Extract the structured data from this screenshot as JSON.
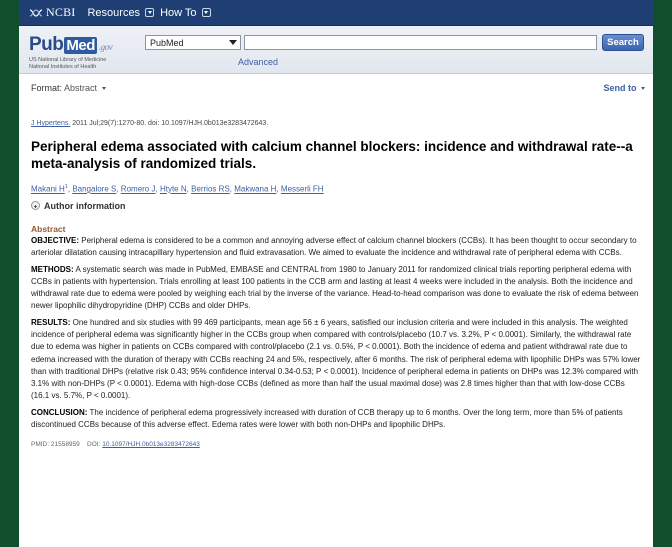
{
  "ncbi_bar": {
    "logo": "NCBI",
    "resources": "Resources",
    "howto": "How To"
  },
  "header": {
    "logo_pub": "Pub",
    "logo_med": "Med",
    "logo_gov": ".gov",
    "nlm_line1": "US National Library of Medicine",
    "nlm_line2": "National Institutes of Health",
    "database": "PubMed",
    "search_value": "",
    "search_button": "Search",
    "advanced": "Advanced"
  },
  "format_bar": {
    "format_label": "Format:",
    "format_value": "Abstract",
    "send_to": "Send to"
  },
  "article": {
    "journal": "J Hypertens.",
    "citation_rest": " 2011 Jul;29(7):1270-80. doi: 10.1097/HJH.0b013e3283472643.",
    "title": "Peripheral edema associated with calcium channel blockers: incidence and withdrawal rate--a meta-analysis of randomized trials.",
    "authors": [
      {
        "name": "Makani H",
        "sup": "1"
      },
      {
        "name": "Bangalore S",
        "sup": ""
      },
      {
        "name": "Romero J",
        "sup": ""
      },
      {
        "name": "Htyte N",
        "sup": ""
      },
      {
        "name": "Berrios RS",
        "sup": ""
      },
      {
        "name": "Makwana H",
        "sup": ""
      },
      {
        "name": "Messerli FH",
        "sup": ""
      }
    ],
    "author_info": "Author information",
    "abstract_heading": "Abstract",
    "sections": [
      {
        "label": "OBJECTIVE:",
        "text": " Peripheral edema is considered to be a common and annoying adverse effect of calcium channel blockers (CCBs). It has been thought to occur secondary to arteriolar dilatation causing intracapillary hypertension and fluid extravasation. We aimed to evaluate the incidence and withdrawal rate of peripheral edema with CCBs."
      },
      {
        "label": "METHODS:",
        "text": " A systematic search was made in PubMed, EMBASE and CENTRAL from 1980 to January 2011 for randomized clinical trials reporting peripheral edema with CCBs in patients with hypertension. Trials enrolling at least 100 patients in the CCB arm and lasting at least 4 weeks were included in the analysis. Both the incidence and withdrawal rate due to edema were pooled by weighing each trial by the inverse of the variance. Head-to-head comparison was done to evaluate the risk of edema between newer lipophilic dihydropyridine (DHP) CCBs and older DHPs."
      },
      {
        "label": "RESULTS:",
        "text": " One hundred and six studies with 99 469 participants, mean age 56 ± 6 years, satisfied our inclusion criteria and were included in this analysis. The weighted incidence of peripheral edema was significantly higher in the CCBs group when compared with controls/placebo (10.7 vs. 3.2%, P < 0.0001). Similarly, the withdrawal rate due to edema was higher in patients on CCBs compared with control/placebo (2.1 vs. 0.5%, P < 0.0001). Both the incidence of edema and patient withdrawal rate due to edema increased with the duration of therapy with CCBs reaching 24 and 5%, respectively, after 6 months. The risk of peripheral edema with lipophilic DHPs was 57% lower than with traditional DHPs (relative risk 0.43; 95% confidence interval 0.34-0.53; P < 0.0001). Incidence of peripheral edema in patients on DHPs was 12.3% compared with 3.1% with non-DHPs (P < 0.0001). Edema with high-dose CCBs (defined as more than half the usual maximal dose) was 2.8 times higher than that with low-dose CCBs (16.1 vs. 5.7%, P < 0.0001)."
      },
      {
        "label": "CONCLUSION:",
        "text": " The incidence of peripheral edema progressively increased with duration of CCB therapy up to 6 months. Over the long term, more than 5% of patients discontinued CCBs because of this adverse effect. Edema rates were lower with both non-DHPs and lipophilic DHPs."
      }
    ],
    "pmid_label": "PMID: 21558959",
    "doi_label": "DOI:",
    "doi_link": "10.1097/HJH.0b013e3283472643"
  },
  "colors": {
    "background": "#0f4f2c",
    "ncbi_bar": "#1f3f74",
    "link": "#3d5fa3",
    "abstract_heading": "#985735"
  }
}
